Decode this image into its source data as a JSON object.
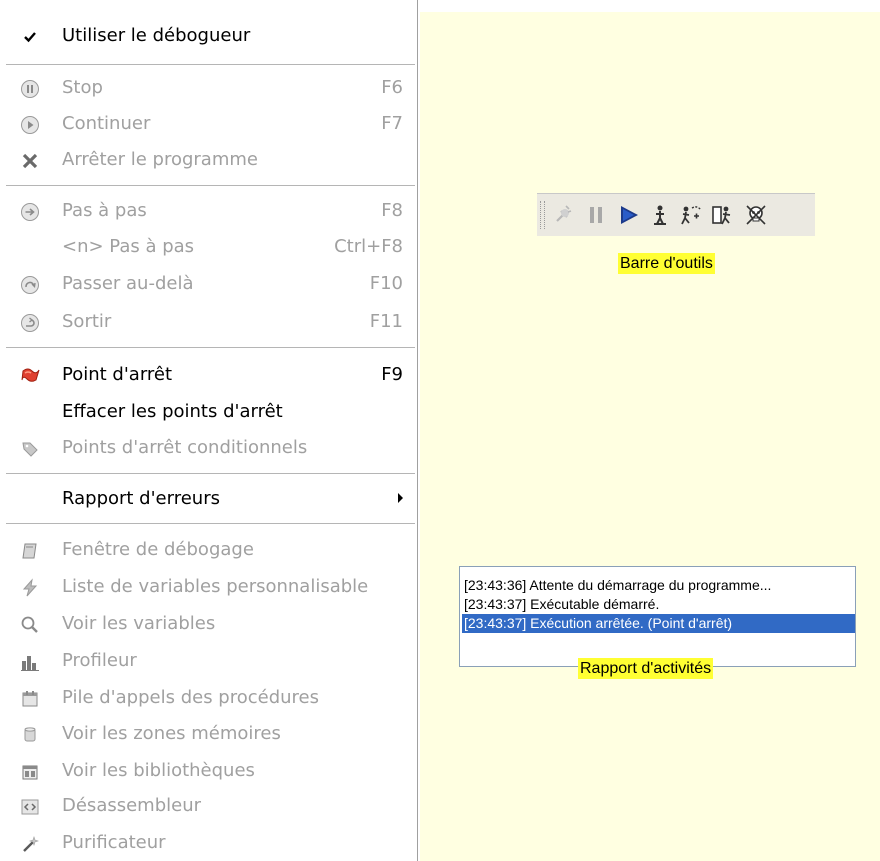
{
  "menu": {
    "items": [
      {
        "label": "Utiliser le débogueur",
        "shortcut": "",
        "icon": "checkmark-icon",
        "enabled": true
      },
      {
        "label": "Stop",
        "shortcut": "F6",
        "icon": "pause-icon",
        "enabled": false
      },
      {
        "label": "Continuer",
        "shortcut": "F7",
        "icon": "play-icon",
        "enabled": false
      },
      {
        "label": "Arrêter le programme",
        "shortcut": "",
        "icon": "kill-icon",
        "enabled": false
      },
      {
        "label": "Pas à pas",
        "shortcut": "F8",
        "icon": "step-icon",
        "enabled": false
      },
      {
        "label": "<n> Pas à pas",
        "shortcut": "Ctrl+F8",
        "icon": "",
        "enabled": false
      },
      {
        "label": "Passer au-delà",
        "shortcut": "F10",
        "icon": "step-over-icon",
        "enabled": false
      },
      {
        "label": "Sortir",
        "shortcut": "F11",
        "icon": "step-out-icon",
        "enabled": false
      },
      {
        "label": "Point d'arrêt",
        "shortcut": "F9",
        "icon": "breakpoint-flag-icon",
        "enabled": true
      },
      {
        "label": "Effacer les points d'arrêt",
        "shortcut": "",
        "icon": "",
        "enabled": true
      },
      {
        "label": "Points d'arrêt conditionnels",
        "shortcut": "",
        "icon": "tag-icon",
        "enabled": false
      },
      {
        "label": "Rapport d'erreurs",
        "shortcut": "",
        "icon": "",
        "enabled": true
      },
      {
        "label": "Fenêtre de débogage",
        "shortcut": "",
        "icon": "debug-window-icon",
        "enabled": false
      },
      {
        "label": "Liste de variables personnalisable",
        "shortcut": "",
        "icon": "lightning-icon",
        "enabled": false
      },
      {
        "label": "Voir les variables",
        "shortcut": "",
        "icon": "magnifier-icon",
        "enabled": false
      },
      {
        "label": "Profileur",
        "shortcut": "",
        "icon": "bar-chart-icon",
        "enabled": false
      },
      {
        "label": "Pile d'appels des procédures",
        "shortcut": "",
        "icon": "calendar-icon",
        "enabled": false
      },
      {
        "label": "Voir les zones mémoires",
        "shortcut": "",
        "icon": "cylinder-icon",
        "enabled": false
      },
      {
        "label": "Voir les bibliothèques",
        "shortcut": "",
        "icon": "library-icon",
        "enabled": false
      },
      {
        "label": "Désassembleur",
        "shortcut": "",
        "icon": "code-icon",
        "enabled": false
      },
      {
        "label": "Purificateur",
        "shortcut": "",
        "icon": "wand-icon",
        "enabled": false
      }
    ]
  },
  "toolbar": {
    "caption": "Barre d'outils",
    "buttons": [
      "debugger-toggle-icon",
      "pause-icon",
      "play-icon",
      "step-icon",
      "step-over-icon",
      "step-out-icon",
      "kill-icon"
    ]
  },
  "log": {
    "caption": "Rapport d'activités",
    "lines": [
      "[23:43:36] Attente du démarrage du programme...",
      "[23:43:37] Exécutable démarré.",
      "[23:43:37] Exécution arrêtée. (Point d'arrêt)"
    ],
    "selected_index": 2
  },
  "colors": {
    "help_background": "#ffffe1",
    "caption_highlight": "#ffff33",
    "selection": "#316ac5",
    "disabled_text": "#a0a0a0"
  }
}
